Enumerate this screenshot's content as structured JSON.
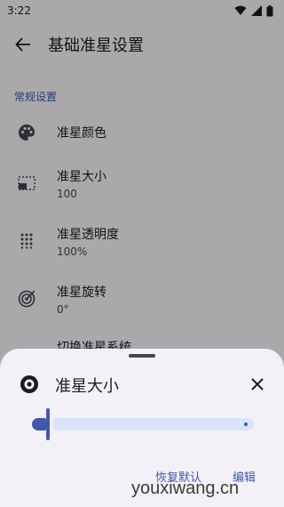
{
  "status_bar": {
    "time": "3:22",
    "icons": [
      "wifi-icon",
      "signal-icon",
      "battery-icon"
    ]
  },
  "app_bar": {
    "title": "基础准星设置",
    "back_icon": "arrow-back-icon"
  },
  "section": {
    "header": "常规设置"
  },
  "settings": [
    {
      "title": "准星颜色",
      "summary": "",
      "icon": "palette-icon"
    },
    {
      "title": "准星大小",
      "summary": "100",
      "icon": "size-icon"
    },
    {
      "title": "准星透明度",
      "summary": "100%",
      "icon": "opacity-icon"
    },
    {
      "title": "准星旋转",
      "summary": "0°",
      "icon": "rotate-icon"
    },
    {
      "title": "切换准星系统",
      "summary": "",
      "icon": "switch-icon"
    }
  ],
  "sheet": {
    "title": "准星大小",
    "icon": "target-icon",
    "close_icon": "close-icon",
    "slider_value_fraction": 0.02,
    "reset_label": "恢复默认",
    "edit_label": "编辑"
  },
  "watermark": "youxiwang.cn",
  "colors": {
    "accent": "#3f5aa9",
    "sheet_bg": "#f4f0f8",
    "track_inactive": "#dbe3f8"
  }
}
